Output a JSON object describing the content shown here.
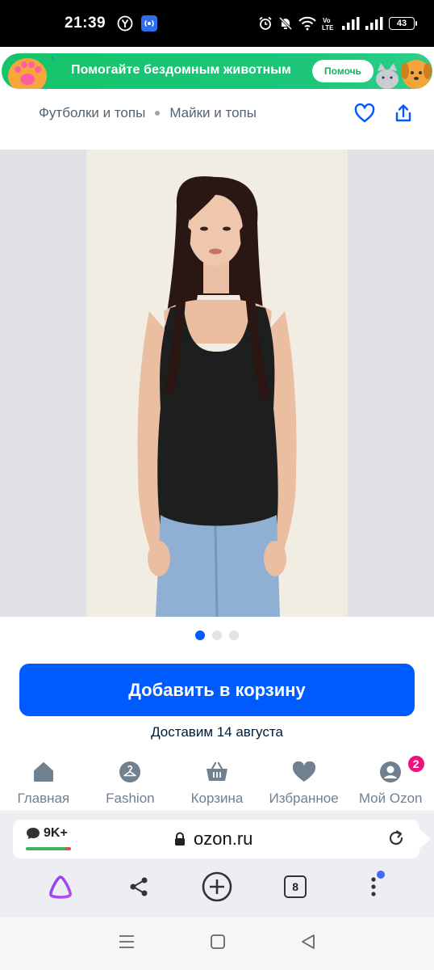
{
  "status_bar": {
    "time": "21:39",
    "battery": "43"
  },
  "banner": {
    "text": "Помогайте бездомным животным",
    "button": "Помочь"
  },
  "breadcrumb": {
    "items": [
      "Футболки и топы",
      "Майки и топы"
    ]
  },
  "gallery": {
    "total_images": 3,
    "active_index": 0
  },
  "colors": {
    "accent": "#005bff",
    "badge": "#f1117e",
    "banner": "#14c46a"
  },
  "actions": {
    "add_to_cart": "Добавить в корзину",
    "delivery": "Доставим 14 августа"
  },
  "tabbar": {
    "items": [
      {
        "label": "Главная",
        "icon": "home-icon"
      },
      {
        "label": "Fashion",
        "icon": "hanger-icon"
      },
      {
        "label": "Корзина",
        "icon": "basket-icon"
      },
      {
        "label": "Избранное",
        "icon": "heart-icon"
      },
      {
        "label": "Мой Ozon",
        "icon": "profile-icon",
        "badge": "2"
      }
    ]
  },
  "browser": {
    "comments": "9K+",
    "url": "ozon.ru",
    "tab_count": "8"
  }
}
